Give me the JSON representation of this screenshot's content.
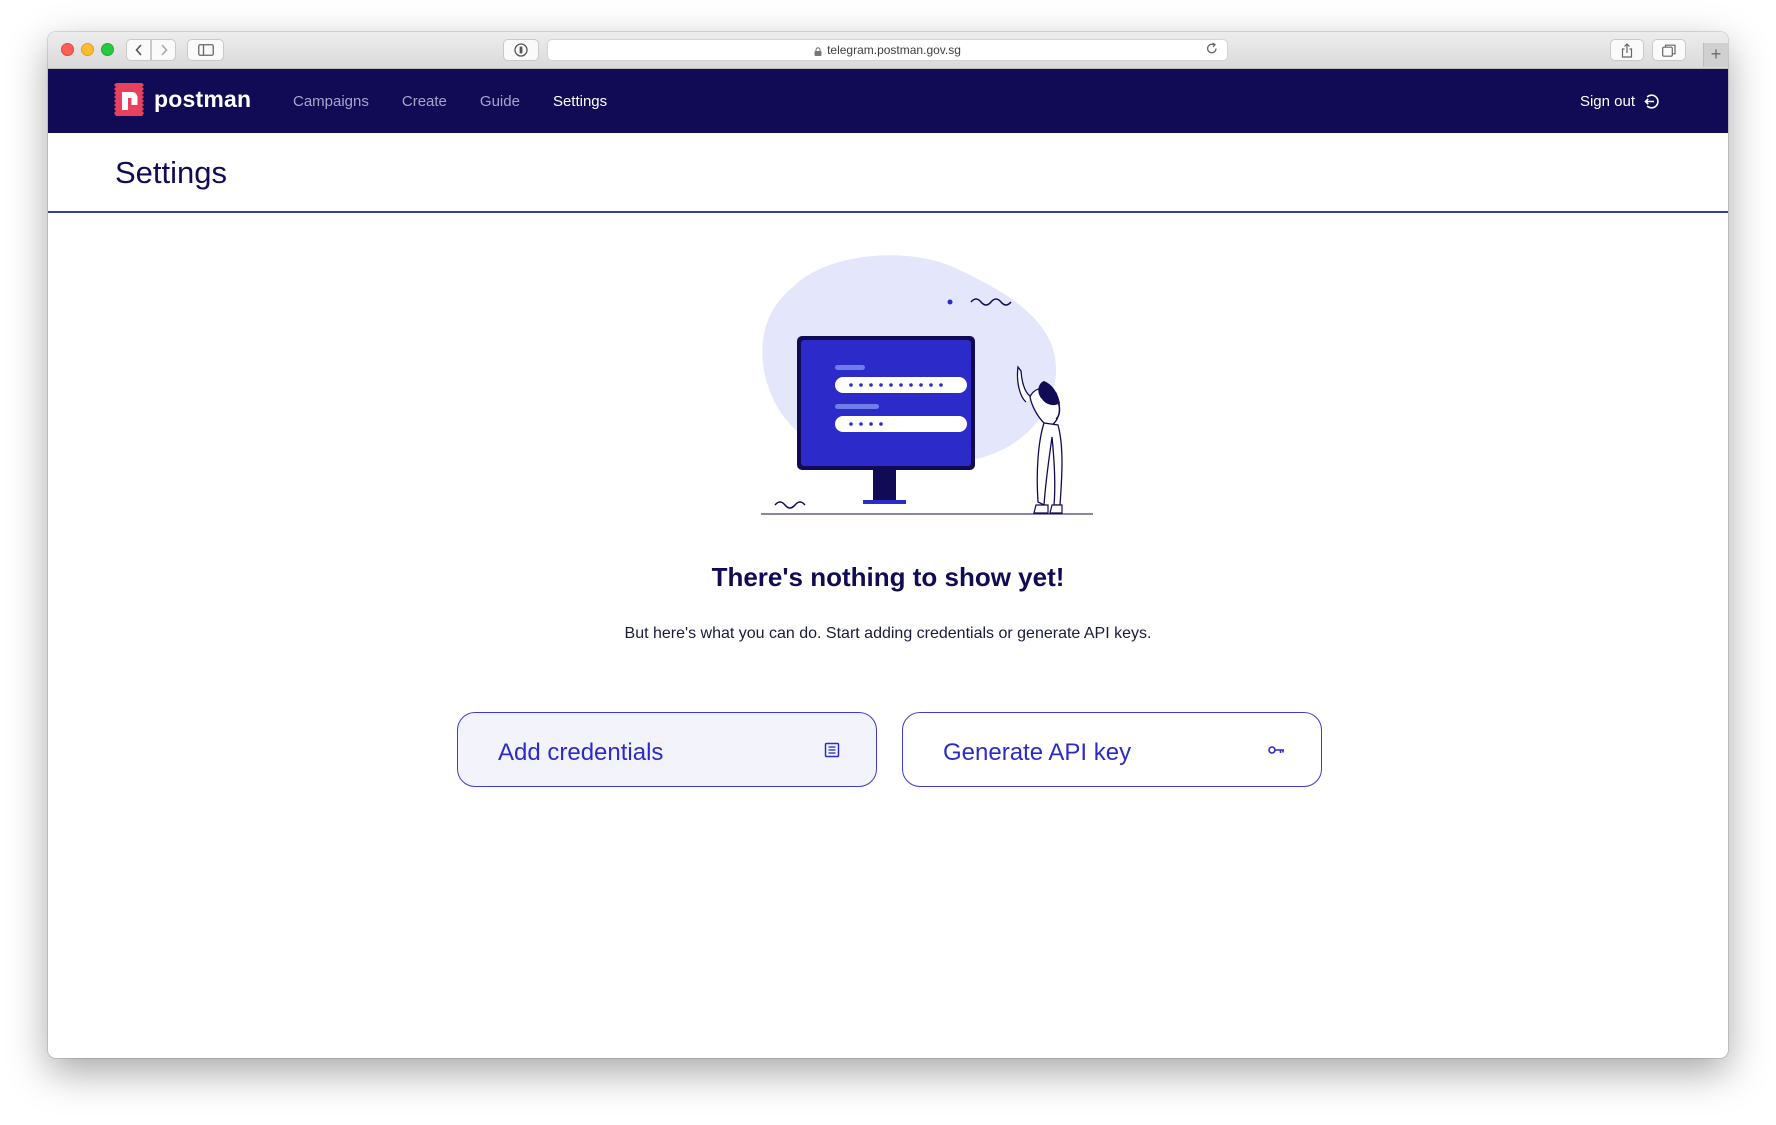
{
  "browser": {
    "url": "telegram.postman.gov.sg",
    "new_tab_symbol": "+"
  },
  "nav": {
    "brand": "postman",
    "links": [
      "Campaigns",
      "Create",
      "Guide",
      "Settings"
    ],
    "active": "Settings",
    "sign_out": "Sign out"
  },
  "page": {
    "title": "Settings"
  },
  "empty_state": {
    "title": "There's nothing to show yet!",
    "subtitle": "But here's what you can do. Start adding credentials or generate API keys."
  },
  "actions": {
    "add_credentials": "Add credentials",
    "generate_api_key": "Generate API key"
  },
  "colors": {
    "nav_bg": "#110b56",
    "accent": "#3b3bd8",
    "brand_red": "#e8415d"
  }
}
